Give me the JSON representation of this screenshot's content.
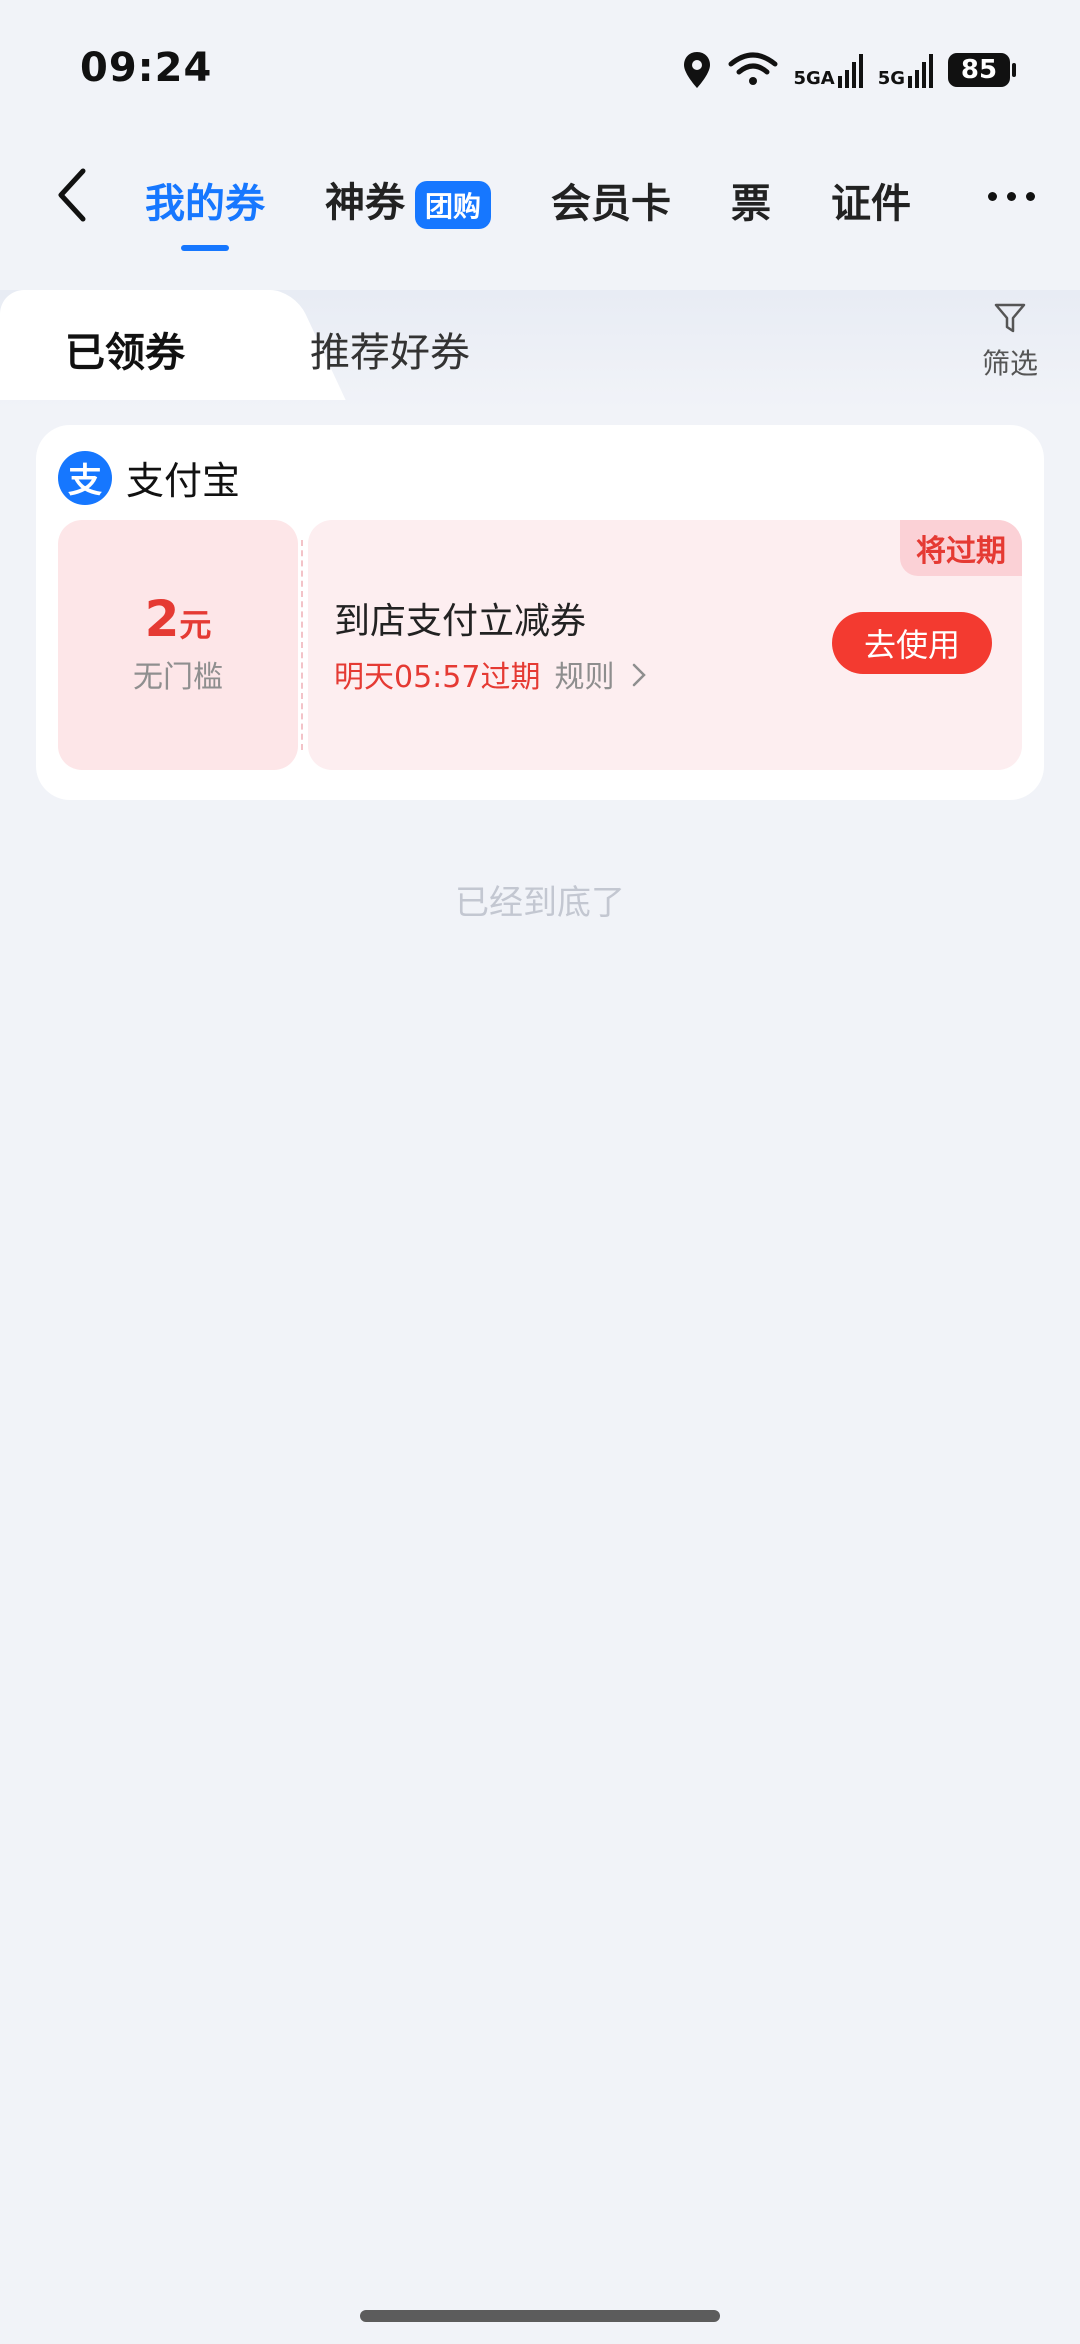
{
  "status_bar": {
    "time": "09:24",
    "network_1": "5GA",
    "network_2": "5G",
    "battery": "85"
  },
  "nav": {
    "tabs": [
      {
        "label": "我的券"
      },
      {
        "label": "神券",
        "badge": "团购"
      },
      {
        "label": "会员卡"
      },
      {
        "label": "票"
      },
      {
        "label": "证件"
      }
    ]
  },
  "subtabs": {
    "active": "已领券",
    "inactive": "推荐好券",
    "filter_label": "筛选"
  },
  "card": {
    "merchant": "支付宝",
    "merchant_icon_text": "支",
    "coupon": {
      "amount": "2",
      "unit": "元",
      "threshold": "无门槛",
      "title": "到店支付立减券",
      "expire": "明天05:57过期",
      "rules": "规则",
      "badge": "将过期",
      "button": "去使用"
    }
  },
  "bottom_note": "已经到底了",
  "colors": {
    "primary_blue": "#1677ff",
    "accent_red": "#f33a30",
    "card_pink": "#fdeef0"
  }
}
